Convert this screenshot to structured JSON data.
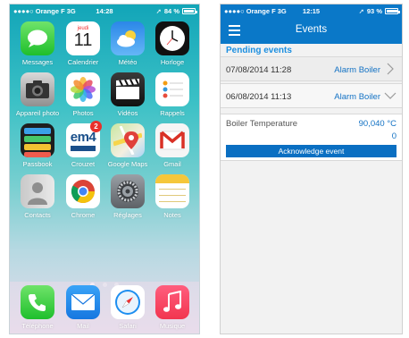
{
  "home": {
    "status": {
      "carrier": "Orange F",
      "network": "3G",
      "time": "14:28",
      "battery": "84 %",
      "battery_level": 0.84
    },
    "apps": [
      {
        "label": "Messages",
        "icon": "messages-icon"
      },
      {
        "label": "Calendrier",
        "icon": "calendar-icon",
        "day": "jeudi",
        "date": "11"
      },
      {
        "label": "Météo",
        "icon": "weather-icon"
      },
      {
        "label": "Horloge",
        "icon": "clock-icon"
      },
      {
        "label": "Appareil photo",
        "icon": "camera-icon"
      },
      {
        "label": "Photos",
        "icon": "photos-icon"
      },
      {
        "label": "Vidéos",
        "icon": "videos-icon"
      },
      {
        "label": "Rappels",
        "icon": "reminders-icon"
      },
      {
        "label": "Passbook",
        "icon": "passbook-icon"
      },
      {
        "label": "Crouzet",
        "icon": "crouzet-icon",
        "badge": "2",
        "text": "em4"
      },
      {
        "label": "Google Maps",
        "icon": "maps-icon"
      },
      {
        "label": "Gmail",
        "icon": "gmail-icon"
      },
      {
        "label": "Contacts",
        "icon": "contacts-icon"
      },
      {
        "label": "Chrome",
        "icon": "chrome-icon"
      },
      {
        "label": "Réglages",
        "icon": "settings-icon"
      },
      {
        "label": "Notes",
        "icon": "notes-icon"
      }
    ],
    "dock": [
      {
        "label": "Téléphone",
        "icon": "phone-icon"
      },
      {
        "label": "Mail",
        "icon": "mail-icon"
      },
      {
        "label": "Safari",
        "icon": "safari-icon"
      },
      {
        "label": "Musique",
        "icon": "music-icon"
      }
    ]
  },
  "events_app": {
    "status": {
      "carrier": "Orange F",
      "network": "3G",
      "time": "12:15",
      "battery": "93 %",
      "battery_level": 0.93
    },
    "title": "Events",
    "section_title": "Pending events",
    "events": [
      {
        "date": "07/08/2014 11:28",
        "name": "Alarm Boiler"
      },
      {
        "date": "06/08/2014 11:13",
        "name": "Alarm Boiler"
      }
    ],
    "detail": {
      "label": "Boiler Temperature",
      "value": "90,040 °C",
      "value2": "0"
    },
    "ack_button": "Acknowledge event",
    "colors": {
      "accent": "#0a78c8",
      "link": "#1372c4"
    }
  }
}
